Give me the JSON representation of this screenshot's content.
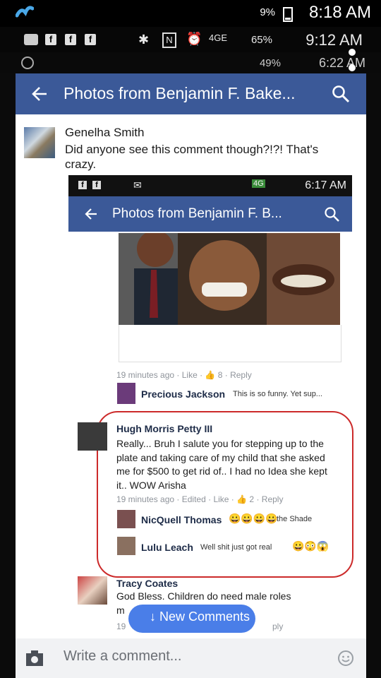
{
  "outer_status_1": {
    "battery": "9%",
    "time": "8:18 AM"
  },
  "outer_status_2": {
    "network": "4GE",
    "battery": "65%",
    "time": "9:12 AM"
  },
  "outer_status_3": {
    "battery": "49%",
    "time": "6:22 AM"
  },
  "outer_appbar": {
    "title": "Photos from Benjamin F. Bake..."
  },
  "post_comment": {
    "author": "Genelha Smith",
    "text": "Did anyone see this comment though?!?! That's crazy."
  },
  "inner_status": {
    "network": "4G",
    "time": "6:17 AM"
  },
  "inner_appbar": {
    "title": "Photos from Benjamin F. B..."
  },
  "photo_meta": {
    "time": "19 minutes ago",
    "like": "Like",
    "likes": "8",
    "reply": "Reply"
  },
  "comments": [
    {
      "author": "Precious Jackson",
      "text": "This is so funny. Yet sup..."
    },
    {
      "author": "Hugh Morris Petty III",
      "text": "Really... Bruh I salute you for stepping up to the plate and taking care of my child that she asked me for $500 to get rid of.. I had no Idea she kept it.. WOW Arisha",
      "time": "19 minutes ago",
      "edited": "Edited",
      "like": "Like",
      "likes": "2",
      "reply": "Reply"
    },
    {
      "author": "NicQuell Thomas",
      "text": "the Shade"
    },
    {
      "author": "Lulu Leach",
      "text": "Well shit just got real"
    },
    {
      "author": "Tracy Coates",
      "text_line1": "God Bless. Children do need male roles",
      "text_line2": "m",
      "time": "19",
      "reply_fragment": "ply"
    }
  ],
  "new_comments_pill": "↓ New Comments",
  "compose": {
    "placeholder": "Write a comment..."
  },
  "colors": {
    "facebook_blue": "#3b5998",
    "pill_blue": "#4a7ee8",
    "highlight_red": "#cc2a2a"
  }
}
